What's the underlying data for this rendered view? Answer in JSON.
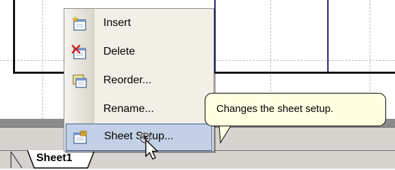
{
  "context_menu": {
    "items": [
      {
        "label": "Insert",
        "icon": "insert-sheet-icon"
      },
      {
        "label": "Delete",
        "icon": "delete-sheet-icon"
      },
      {
        "label": "Reorder...",
        "icon": "reorder-sheets-icon"
      },
      {
        "label": "Rename...",
        "icon": ""
      },
      {
        "label": "Sheet Setup...",
        "icon": "sheet-setup-icon",
        "highlighted": true
      }
    ]
  },
  "tooltip": {
    "text": "Changes the sheet setup."
  },
  "sheet_tabs": [
    {
      "label": "Sheet1",
      "active": true
    }
  ],
  "colors": {
    "menu_background": "#f1efe6",
    "highlight_background": "#c3d0e6",
    "highlight_border": "#3d5f9a",
    "tooltip_background": "#ffffe1",
    "page_border_blue": "#22247a"
  }
}
